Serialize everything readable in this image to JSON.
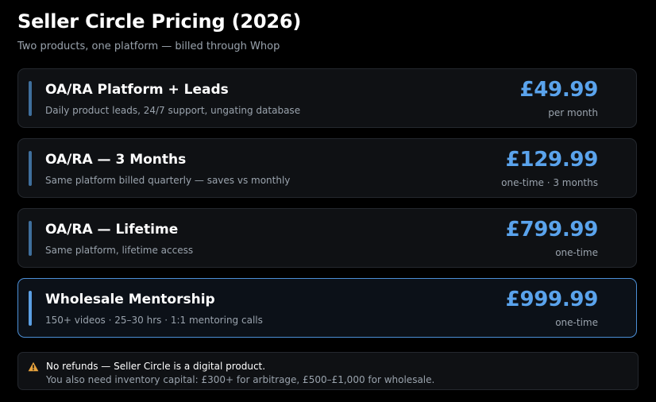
{
  "header": {
    "title": "Seller Circle Pricing (2026)",
    "subtitle": "Two products, one platform — billed through Whop"
  },
  "plans": [
    {
      "name": "OA/RA Platform + Leads",
      "description": "Daily product leads, 24/7 support, ungating database",
      "price": "£49.99",
      "period": "per month"
    },
    {
      "name": "OA/RA — 3 Months",
      "description": "Same platform billed quarterly — saves vs monthly",
      "price": "£129.99",
      "period": "one-time · 3 months"
    },
    {
      "name": "OA/RA — Lifetime",
      "description": "Same platform, lifetime access",
      "price": "£799.99",
      "period": "one-time"
    },
    {
      "name": "Wholesale Mentorship",
      "description": "150+ videos · 25–30 hrs · 1:1 mentoring calls",
      "price": "£999.99",
      "period": "one-time",
      "highlighted": true
    }
  ],
  "notice": {
    "icon": "warning-icon",
    "line1": "No refunds — Seller Circle is a digital product.",
    "line2": "You also need inventory capital: £300+ for arbitrage, £500–£1,000 for wholesale."
  },
  "colors": {
    "background": "#000000",
    "card": "#0f1114",
    "price_accent": "#5aa3ec",
    "highlight_border": "#4c8fd6",
    "warning": "#e8a33d"
  }
}
